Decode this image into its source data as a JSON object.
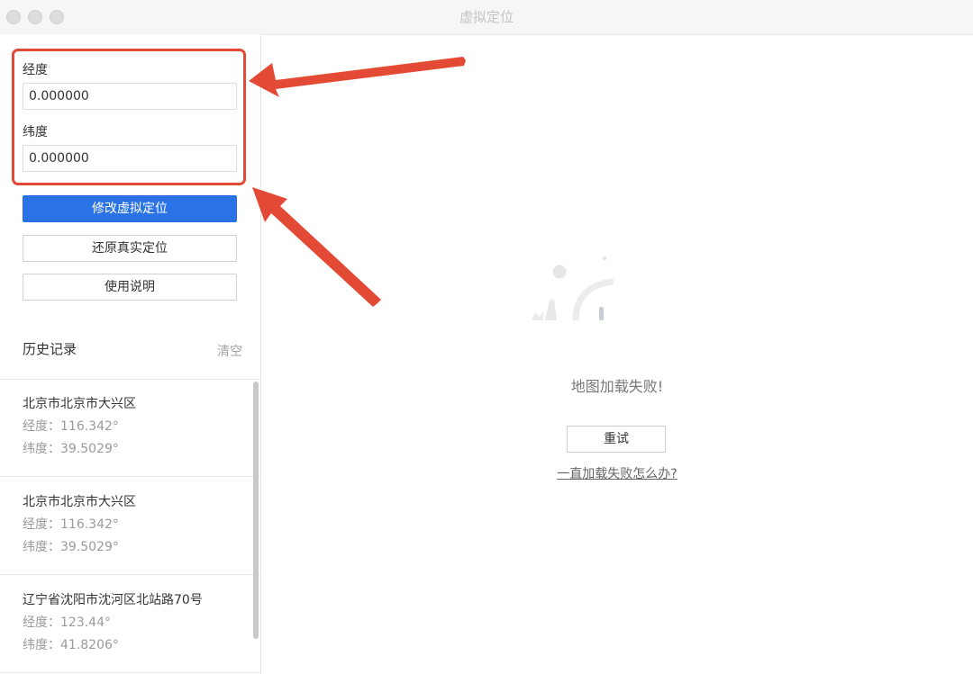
{
  "window": {
    "title": "虚拟定位"
  },
  "form": {
    "longitude_label": "经度",
    "longitude_value": "0.000000",
    "latitude_label": "纬度",
    "latitude_value": "0.000000"
  },
  "buttons": {
    "modify": "修改虚拟定位",
    "restore": "还原真实定位",
    "help": "使用说明"
  },
  "history": {
    "title": "历史记录",
    "clear": "清空",
    "items": [
      {
        "address": "北京市北京市大兴区",
        "longitude": "经度：116.342°",
        "latitude": "纬度：39.5029°"
      },
      {
        "address": "北京市北京市大兴区",
        "longitude": "经度：116.342°",
        "latitude": "纬度：39.5029°"
      },
      {
        "address": "辽宁省沈阳市沈河区北站路70号",
        "longitude": "经度：123.44°",
        "latitude": "纬度：41.8206°"
      }
    ]
  },
  "map": {
    "error_text": "地图加载失败!",
    "retry": "重试",
    "help_link": "一直加载失败怎么办?"
  },
  "colors": {
    "primary": "#2a72e5",
    "annotation": "#e34a36"
  }
}
